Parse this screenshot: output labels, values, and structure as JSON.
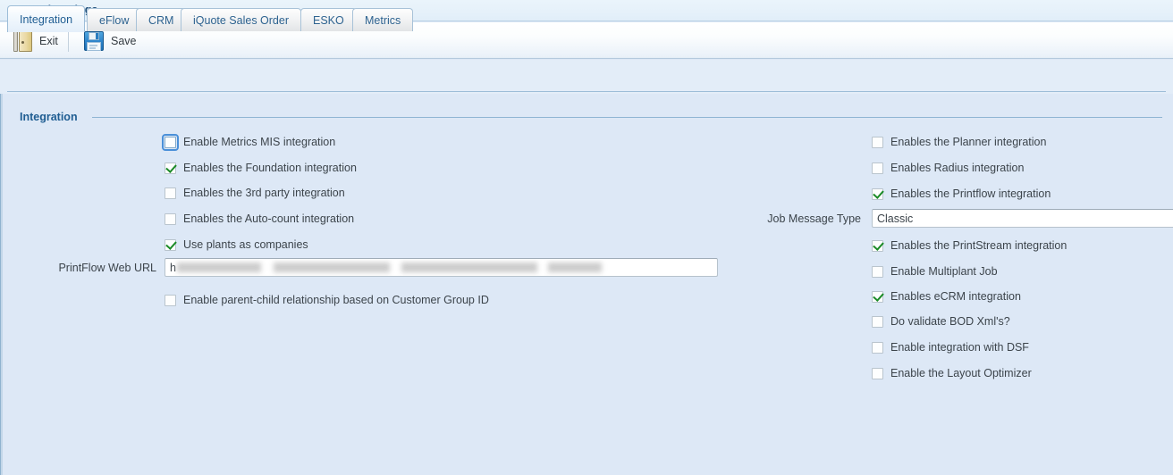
{
  "window": {
    "title": "General settings"
  },
  "toolbar": {
    "exit_label": "Exit",
    "exit_icon": "door-icon",
    "save_label": "Save",
    "save_icon": "floppy-disk-icon"
  },
  "tabs": [
    {
      "label": "Integration",
      "active": true
    },
    {
      "label": "eFlow",
      "active": false
    },
    {
      "label": "CRM",
      "active": false
    },
    {
      "label": "iQuote Sales Order",
      "active": false
    },
    {
      "label": "ESKO",
      "active": false
    },
    {
      "label": "Metrics",
      "active": false
    }
  ],
  "group": {
    "title": "Integration"
  },
  "left_column": {
    "checkboxes": [
      {
        "label": "Enable Metrics MIS integration",
        "checked": false,
        "focused": true
      },
      {
        "label": "Enables the Foundation integration",
        "checked": true,
        "focused": false
      },
      {
        "label": "Enables the 3rd party integration",
        "checked": false,
        "focused": false
      },
      {
        "label": "Enables the Auto-count integration",
        "checked": false,
        "focused": false
      },
      {
        "label": "Use plants as companies",
        "checked": true,
        "focused": false
      }
    ],
    "printflow_web_url": {
      "label": "PrintFlow Web URL",
      "value_visible_prefix": "h",
      "value_redacted": true
    },
    "parent_child": {
      "label": "Enable parent-child relationship based on Customer Group ID",
      "checked": false
    }
  },
  "right_column": {
    "checkboxes_top": [
      {
        "label": "Enables the Planner integration",
        "checked": false
      },
      {
        "label": "Enables Radius integration",
        "checked": false
      },
      {
        "label": "Enables the Printflow integration",
        "checked": true
      }
    ],
    "job_message_type": {
      "label": "Job Message Type",
      "value": "Classic",
      "options": [
        "Classic"
      ]
    },
    "checkboxes_bottom": [
      {
        "label": "Enables the PrintStream integration",
        "checked": true
      },
      {
        "label": "Enable Multiplant Job",
        "checked": false
      },
      {
        "label": "Enables eCRM integration",
        "checked": true
      },
      {
        "label": "Do validate BOD Xml's?",
        "checked": false
      },
      {
        "label": "Enable integration with DSF",
        "checked": false
      },
      {
        "label": "Enable the Layout Optimizer",
        "checked": false
      }
    ]
  },
  "colors": {
    "title_text": "#1f4e79",
    "content_bg": "#dde8f6",
    "accent": "#1f5d92",
    "check_green": "#1a8a26",
    "focus_blue": "#4a90d9"
  }
}
